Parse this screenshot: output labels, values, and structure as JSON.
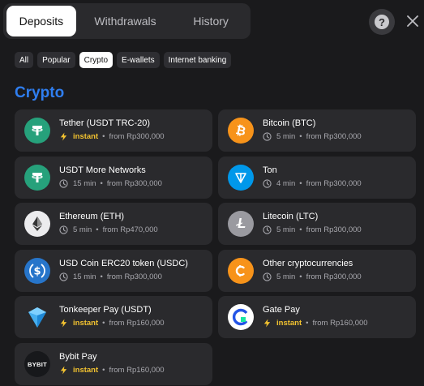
{
  "tabs": [
    {
      "label": "Deposits",
      "active": true
    },
    {
      "label": "Withdrawals",
      "active": false
    },
    {
      "label": "History",
      "active": false
    }
  ],
  "help_label": "?",
  "filters": [
    {
      "label": "All",
      "active": false
    },
    {
      "label": "Popular",
      "active": false
    },
    {
      "label": "Crypto",
      "active": true
    },
    {
      "label": "E-wallets",
      "active": false
    },
    {
      "label": "Internet banking",
      "active": false
    }
  ],
  "section_title": "Crypto",
  "methods": [
    {
      "name": "Tether (USDT TRC-20)",
      "speed": "instant",
      "limit": "from Rp300,000",
      "icon": "tether-icon"
    },
    {
      "name": "Bitcoin (BTC)",
      "speed": "5 min",
      "limit": "from Rp300,000",
      "icon": "bitcoin-icon"
    },
    {
      "name": "USDT More Networks",
      "speed": "15 min",
      "limit": "from Rp300,000",
      "icon": "tether-icon"
    },
    {
      "name": "Ton",
      "speed": "4 min",
      "limit": "from Rp300,000",
      "icon": "ton-icon"
    },
    {
      "name": "Ethereum (ETH)",
      "speed": "5 min",
      "limit": "from Rp470,000",
      "icon": "ethereum-icon"
    },
    {
      "name": "Litecoin (LTC)",
      "speed": "5 min",
      "limit": "from Rp300,000",
      "icon": "litecoin-icon"
    },
    {
      "name": "USD Coin ERC20 token (USDC)",
      "speed": "15 min",
      "limit": "from Rp300,000",
      "icon": "usdc-icon"
    },
    {
      "name": "Other cryptocurrencies",
      "speed": "5 min",
      "limit": "from Rp300,000",
      "icon": "crypto-icon"
    },
    {
      "name": "Tonkeeper Pay (USDT)",
      "speed": "instant",
      "limit": "from Rp160,000",
      "icon": "tonkeeper-icon"
    },
    {
      "name": "Gate Pay",
      "speed": "instant",
      "limit": "from Rp160,000",
      "icon": "gate-icon"
    },
    {
      "name": "Bybit Pay",
      "speed": "instant",
      "limit": "from Rp160,000",
      "icon": "bybit-icon",
      "logo_text": "BYBIT"
    }
  ],
  "colors": {
    "accent": "#2f7ef0",
    "instant": "#f2c230",
    "tether": "#26a17b",
    "bitcoin": "#f7931a",
    "ton": "#0098ea",
    "usdc": "#2775ca"
  }
}
